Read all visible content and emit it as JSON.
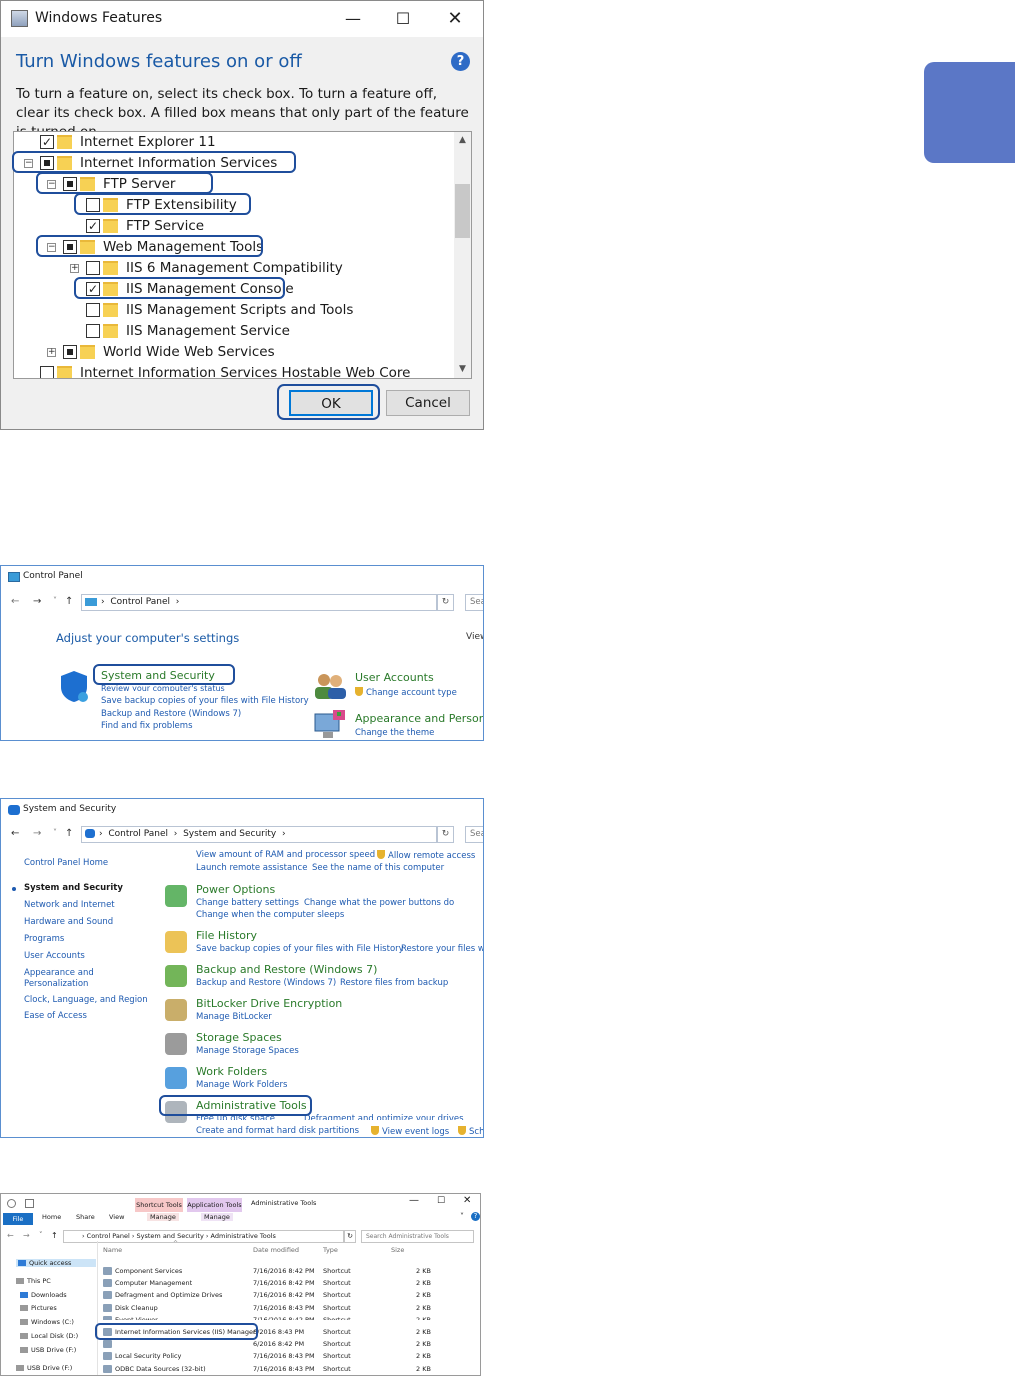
{
  "windows_features": {
    "title": "Windows Features",
    "heading": "Turn Windows features on or off",
    "help_glyph": "?",
    "description": "To turn a feature on, select its check box. To turn a feature off, clear its check box. A filled box means that only part of the feature is turned on.",
    "tree": [
      {
        "label": "Internet Explorer 11",
        "state": "checked",
        "expander": ""
      },
      {
        "label": "Internet Information Services",
        "state": "partial",
        "expander": "−"
      },
      {
        "label": "FTP Server",
        "state": "partial",
        "expander": "−"
      },
      {
        "label": "FTP Extensibility",
        "state": "unchecked",
        "expander": ""
      },
      {
        "label": "FTP Service",
        "state": "checked",
        "expander": ""
      },
      {
        "label": "Web Management Tools",
        "state": "partial",
        "expander": "−"
      },
      {
        "label": "IIS 6 Management Compatibility",
        "state": "unchecked",
        "expander": "+"
      },
      {
        "label": "IIS Management Console",
        "state": "checked",
        "expander": ""
      },
      {
        "label": "IIS Management Scripts and Tools",
        "state": "unchecked",
        "expander": ""
      },
      {
        "label": "IIS Management Service",
        "state": "unchecked",
        "expander": ""
      },
      {
        "label": "World Wide Web Services",
        "state": "partial",
        "expander": "+"
      },
      {
        "label": "Internet Information Services Hostable Web Core",
        "state": "unchecked",
        "expander": ""
      }
    ],
    "ok_label": "OK",
    "cancel_label": "Cancel"
  },
  "control_panel": {
    "title": "Control Panel",
    "address": "Control Panel",
    "search_placeholder": "Sea",
    "heading": "Adjust your computer's settings",
    "view_by": "View",
    "categories": [
      {
        "title": "System and Security",
        "links": [
          "Review your computer's status",
          "Save backup copies of your files with File History",
          "Backup and Restore (Windows 7)",
          "Find and fix problems"
        ]
      },
      {
        "title": "User Accounts",
        "links": [
          "Change account type"
        ]
      },
      {
        "title": "Appearance and Personal",
        "links": [
          "Change the theme"
        ]
      }
    ]
  },
  "system_security": {
    "title": "System and Security",
    "address": "Control Panel",
    "address2": "System and Security",
    "search_placeholder": "Sea",
    "sidebar": [
      "Control Panel Home",
      "System and Security",
      "Network and Internet",
      "Hardware and Sound",
      "Programs",
      "User Accounts",
      "Appearance and Personalization",
      "Clock, Language, and Region",
      "Ease of Access"
    ],
    "top_links": [
      "View amount of RAM and processor speed",
      "Allow remote access",
      "Launch remote assistance",
      "See the name of this computer"
    ],
    "sections": [
      {
        "title": "Power Options",
        "links": [
          "Change battery settings",
          "Change what the power buttons do",
          "Change when the computer sleeps"
        ]
      },
      {
        "title": "File History",
        "links": [
          "Save backup copies of your files with File History",
          "Restore your files with"
        ]
      },
      {
        "title": "Backup and Restore (Windows 7)",
        "links": [
          "Backup and Restore (Windows 7)",
          "Restore files from backup"
        ]
      },
      {
        "title": "BitLocker Drive Encryption",
        "links": [
          "Manage BitLocker"
        ]
      },
      {
        "title": "Storage Spaces",
        "links": [
          "Manage Storage Spaces"
        ]
      },
      {
        "title": "Work Folders",
        "links": [
          "Manage Work Folders"
        ]
      },
      {
        "title": "Administrative Tools",
        "links": [
          "Free up disk space",
          "Defragment and optimize your drives",
          "Create and format hard disk partitions",
          "View event logs",
          "Sch"
        ]
      }
    ]
  },
  "explorer": {
    "title": "Administrative Tools",
    "context_tabs": [
      "Shortcut Tools",
      "Application Tools"
    ],
    "ribbon_tabs": [
      "File",
      "Home",
      "Share",
      "View",
      "Manage",
      "Manage"
    ],
    "address": [
      "Control Panel",
      "System and Security",
      "Administrative Tools"
    ],
    "search_placeholder": "Search Administrative Tools",
    "columns": [
      "Name",
      "Date modified",
      "Type",
      "Size"
    ],
    "sidebar": [
      "Quick access",
      "This PC",
      "Downloads",
      "Pictures",
      "Windows (C:)",
      "Local Disk (D:)",
      "USB Drive (F:)",
      "USB Drive (F:)"
    ],
    "files": [
      {
        "name": "Component Services",
        "date": "7/16/2016 8:42 PM",
        "type": "Shortcut",
        "size": "2 KB"
      },
      {
        "name": "Computer Management",
        "date": "7/16/2016 8:42 PM",
        "type": "Shortcut",
        "size": "2 KB"
      },
      {
        "name": "Defragment and Optimize Drives",
        "date": "7/16/2016 8:42 PM",
        "type": "Shortcut",
        "size": "2 KB"
      },
      {
        "name": "Disk Cleanup",
        "date": "7/16/2016 8:43 PM",
        "type": "Shortcut",
        "size": "2 KB"
      },
      {
        "name": "Event Viewer",
        "date": "7/16/2016 8:42 PM",
        "type": "Shortcut",
        "size": "2 KB"
      },
      {
        "name": "Internet Information Services (IIS) Manager",
        "date": "6/2016 8:43 PM",
        "type": "Shortcut",
        "size": "2 KB"
      },
      {
        "name": "",
        "date": "6/2016 8:42 PM",
        "type": "Shortcut",
        "size": "2 KB"
      },
      {
        "name": "Local Security Policy",
        "date": "7/16/2016 8:43 PM",
        "type": "Shortcut",
        "size": "2 KB"
      },
      {
        "name": "ODBC Data Sources (32-bit)",
        "date": "7/16/2016 8:43 PM",
        "type": "Shortcut",
        "size": "2 KB"
      }
    ]
  },
  "colors": {
    "accent": "#1f4e9c",
    "link": "#1e5ab0",
    "heading_blue": "#1a5aa6",
    "side_tab": "#5b77c6"
  }
}
